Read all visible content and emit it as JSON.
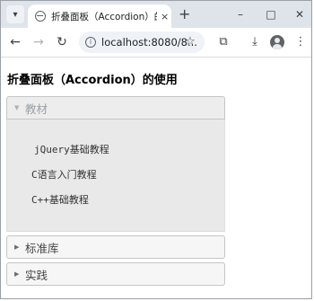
{
  "browser": {
    "tab_title": "折叠面板（Accordion）的使用",
    "tab_close": "×",
    "new_tab": "+",
    "tab_menu_icon": "chevron-down-icon",
    "window_controls": {
      "minimize": "–",
      "maximize": "□",
      "close": "✕"
    },
    "nav": {
      "back": "←",
      "forward": "→",
      "reload": "↻"
    },
    "url": "localhost:8080/8...",
    "toolbar_icons": {
      "bookmark": "☆",
      "extensions": "⧉",
      "download": "⤓",
      "menu": "⋮"
    }
  },
  "page": {
    "title": "折叠面板（Accordion）的使用"
  },
  "accordion": {
    "sections": [
      {
        "label": "教材",
        "expanded": true,
        "items": [
          "jQuery基础教程",
          "C语言入门教程",
          "C++基础教程"
        ]
      },
      {
        "label": "标准库",
        "expanded": false
      },
      {
        "label": "实践",
        "expanded": false
      }
    ],
    "icons": {
      "expanded": "▼",
      "collapsed": "▶"
    }
  },
  "colors": {
    "tabstrip": "#dfe3ea",
    "header_default": "#f6f6f6",
    "header_active": "#ededed",
    "panel_bg": "#e9e9e9",
    "border": "#c5c5c5"
  }
}
